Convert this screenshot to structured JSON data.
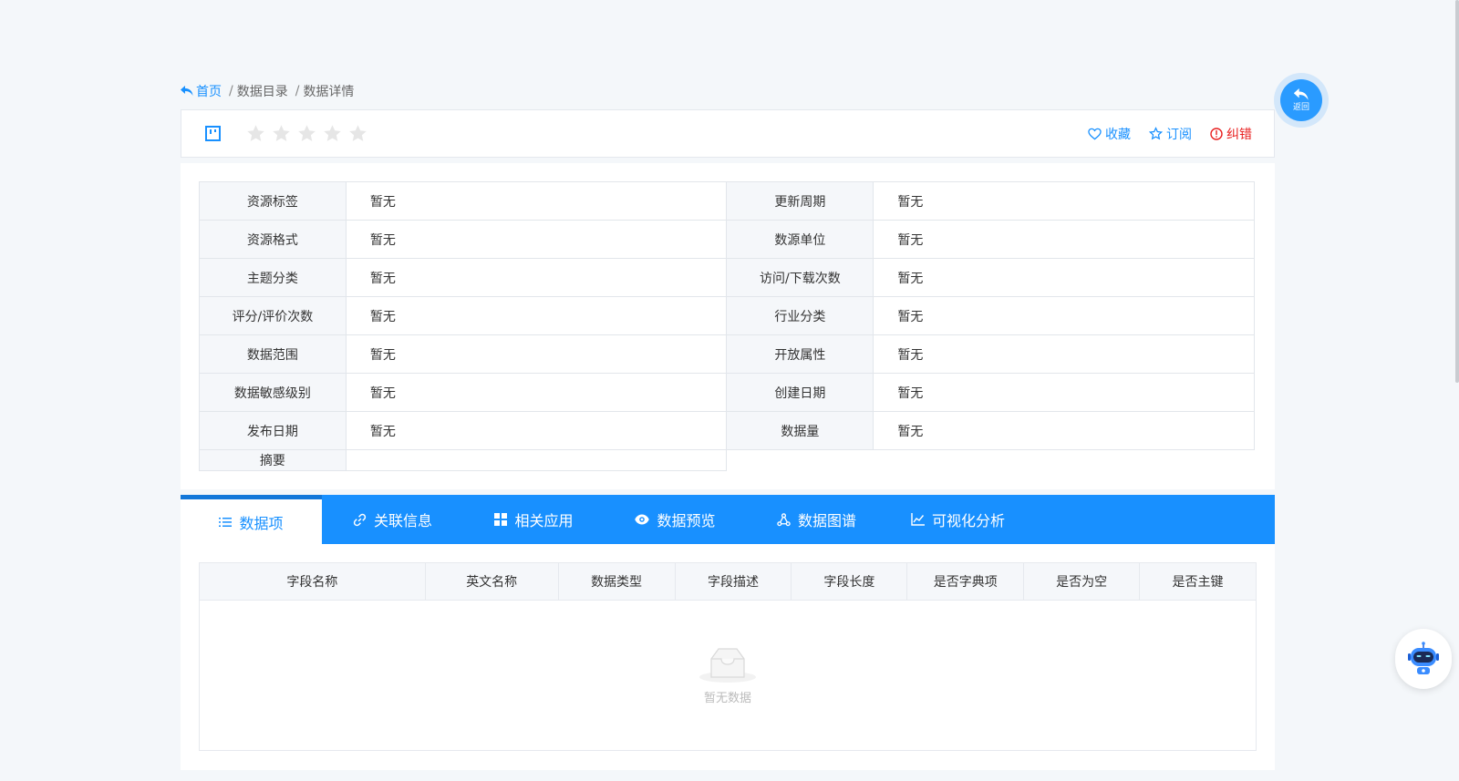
{
  "breadcrumb": {
    "home": "首页",
    "items": [
      "数据目录",
      "数据详情"
    ]
  },
  "header": {
    "rating_stars": 5,
    "rating_value": 0,
    "actions": {
      "favorite": "收藏",
      "subscribe": "订阅",
      "report": "纠错"
    }
  },
  "info": {
    "rows": [
      {
        "l1": "资源标签",
        "v1": "暂无",
        "l2": "更新周期",
        "v2": "暂无"
      },
      {
        "l1": "资源格式",
        "v1": "暂无",
        "l2": "数源单位",
        "v2": "暂无"
      },
      {
        "l1": "主题分类",
        "v1": "暂无",
        "l2": "访问/下载次数",
        "v2": "暂无"
      },
      {
        "l1": "评分/评价次数",
        "v1": "暂无",
        "l2": "行业分类",
        "v2": "暂无"
      },
      {
        "l1": "数据范围",
        "v1": "暂无",
        "l2": "开放属性",
        "v2": "暂无"
      },
      {
        "l1": "数据敏感级别",
        "v1": "暂无",
        "l2": "创建日期",
        "v2": "暂无"
      },
      {
        "l1": "发布日期",
        "v1": "暂无",
        "l2": "数据量",
        "v2": "暂无"
      }
    ],
    "summary_label": "摘要",
    "summary_value": ""
  },
  "tabs": [
    {
      "label": "数据项",
      "icon": "list-icon",
      "active": true
    },
    {
      "label": "关联信息",
      "icon": "link-icon"
    },
    {
      "label": "相关应用",
      "icon": "grid-icon"
    },
    {
      "label": "数据预览",
      "icon": "eye-icon"
    },
    {
      "label": "数据图谱",
      "icon": "graph-icon"
    },
    {
      "label": "可视化分析",
      "icon": "chart-icon"
    }
  ],
  "fields_table": {
    "columns": [
      "字段名称",
      "英文名称",
      "数据类型",
      "字段描述",
      "字段长度",
      "是否字典项",
      "是否为空",
      "是否主键"
    ],
    "empty_text": "暂无数据"
  },
  "back_button": {
    "label": "返回"
  },
  "colors": {
    "accent": "#1890ff",
    "danger": "#e81e1e",
    "star": "#e6e6e6"
  }
}
